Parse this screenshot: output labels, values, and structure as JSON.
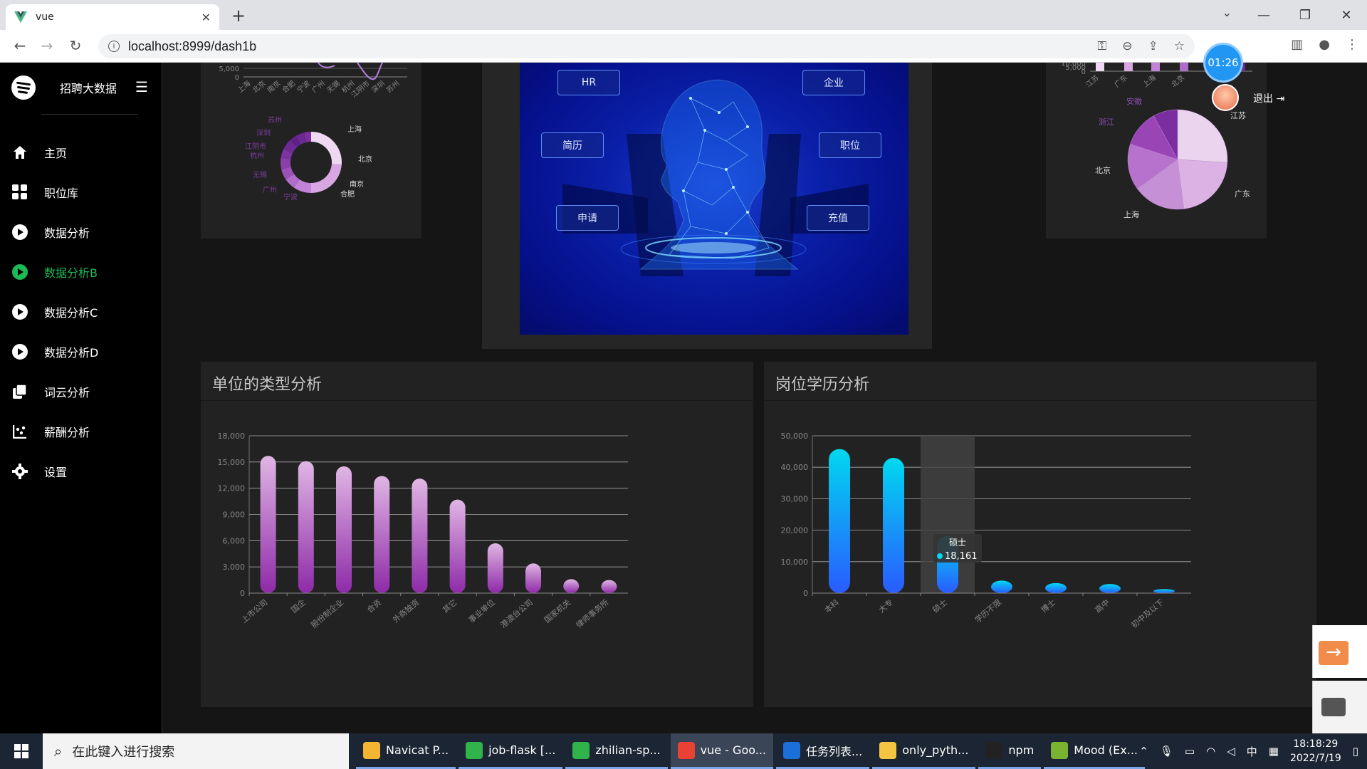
{
  "browser": {
    "tab_title": "vue",
    "url": "localhost:8999/dash1b"
  },
  "app": {
    "title": "招聘大数据",
    "timer": "01:26",
    "logout": "退出"
  },
  "nav": [
    {
      "label": "主页",
      "icon": "home-icon",
      "active": false
    },
    {
      "label": "职位库",
      "icon": "grid-icon",
      "active": false
    },
    {
      "label": "数据分析",
      "icon": "play-circle-icon",
      "active": false
    },
    {
      "label": "数据分析B",
      "icon": "play-circle-icon",
      "active": true
    },
    {
      "label": "数据分析C",
      "icon": "play-circle-icon",
      "active": false
    },
    {
      "label": "数据分析D",
      "icon": "play-circle-icon",
      "active": false
    },
    {
      "label": "词云分析",
      "icon": "copy-icon",
      "active": false
    },
    {
      "label": "薪酬分析",
      "icon": "scatter-icon",
      "active": false
    },
    {
      "label": "设置",
      "icon": "gear-icon",
      "active": false
    }
  ],
  "hero": {
    "boxes": [
      "HR",
      "企业",
      "简历",
      "职位",
      "申请",
      "充值"
    ]
  },
  "colors": {
    "active": "#1db954",
    "purple_top": "#e0b6e4",
    "purple_bottom": "#8e2aa8",
    "cyan_top": "#00d8f0",
    "blue_bottom": "#2a5bff"
  },
  "chart_data": [
    {
      "type": "line",
      "title": "",
      "categories": [
        "上海",
        "北京",
        "南京",
        "合肥",
        "宁波",
        "广州",
        "无锡",
        "杭州",
        "江阴市",
        "深圳",
        "苏州"
      ],
      "y_ticks": [
        "5,000",
        "0"
      ],
      "partial": true
    },
    {
      "type": "pie",
      "variant": "donut",
      "labels": [
        "上海",
        "北京",
        "南京",
        "合肥",
        "宁波",
        "广州",
        "无锡",
        "杭州",
        "江阴市",
        "深圳",
        "苏州"
      ],
      "values": [
        22,
        20,
        8,
        5,
        5,
        5,
        4,
        5,
        3,
        4,
        3
      ]
    },
    {
      "type": "bar",
      "categories": [
        "江苏",
        "广东",
        "上海",
        "北京"
      ],
      "y_ticks": [
        "10,000",
        "5,000",
        "0"
      ],
      "partial": true
    },
    {
      "type": "pie",
      "labels": [
        "江苏",
        "广东",
        "上海",
        "北京",
        "浙江",
        "安徽"
      ],
      "values": [
        26,
        22,
        17,
        15,
        12,
        8
      ]
    },
    {
      "type": "bar",
      "title": "单位的类型分析",
      "categories": [
        "上市公司",
        "国企",
        "股份制企业",
        "合资",
        "外商独资",
        "其它",
        "事业单位",
        "港澳台公司",
        "国家机关",
        "律师事务所"
      ],
      "values": [
        15700,
        15100,
        14500,
        13400,
        13100,
        10700,
        5700,
        3400,
        1600,
        1500
      ],
      "ylim": [
        0,
        18000
      ],
      "y_ticks": [
        "18,000",
        "15,000",
        "12,000",
        "9,000",
        "6,000",
        "3,000",
        "0"
      ]
    },
    {
      "type": "bar",
      "title": "岗位学历分析",
      "categories": [
        "本科",
        "大专",
        "硕士",
        "学历不限",
        "博士",
        "高中",
        "初中及以下"
      ],
      "values": [
        45800,
        43000,
        18161,
        4000,
        3200,
        2900,
        1300
      ],
      "ylim": [
        0,
        50000
      ],
      "y_ticks": [
        "50,000",
        "40,000",
        "30,000",
        "20,000",
        "10,000",
        "0"
      ],
      "tooltip": {
        "label": "硕士",
        "value": "18,161"
      }
    }
  ],
  "taskbar": {
    "search_placeholder": "在此键入进行搜索",
    "apps": [
      {
        "label": "Navicat P...",
        "color": "#f2b632"
      },
      {
        "label": "job-flask [...",
        "color": "#2fb34a"
      },
      {
        "label": "zhilian-sp...",
        "color": "#2fb34a"
      },
      {
        "label": "vue - Goo...",
        "color": "#e94235",
        "active": true
      },
      {
        "label": "任务列表...",
        "color": "#1b6fd8"
      },
      {
        "label": "only_pyth...",
        "color": "#f5c542"
      },
      {
        "label": "npm",
        "color": "#222"
      },
      {
        "label": "Mood (Ex...",
        "color": "#7ab32f"
      }
    ],
    "ime": "中",
    "time": "18:18:29",
    "date": "2022/7/19"
  }
}
